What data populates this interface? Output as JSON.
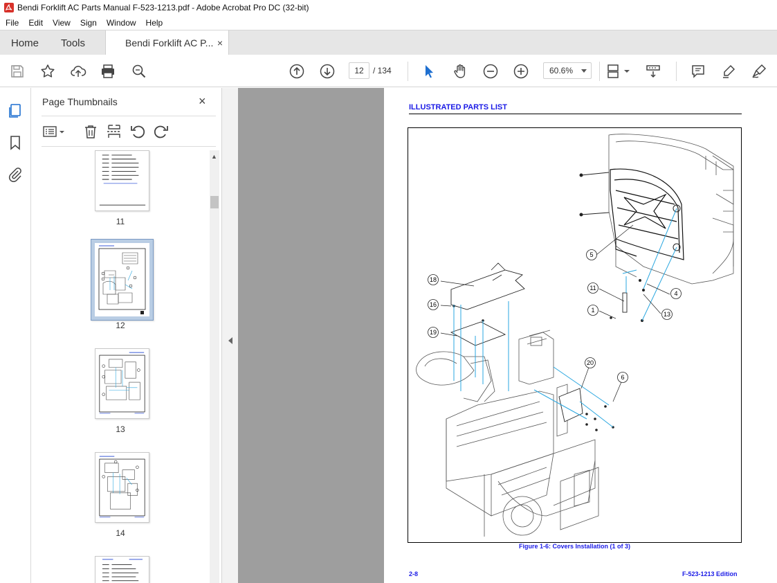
{
  "window": {
    "title": "Bendi Forklift AC Parts Manual F-523-1213.pdf - Adobe Acrobat Pro DC (32-bit)"
  },
  "menu": {
    "items": [
      "File",
      "Edit",
      "View",
      "Sign",
      "Window",
      "Help"
    ]
  },
  "tabs": {
    "home": "Home",
    "tools": "Tools",
    "document": "Bendi Forklift AC P...",
    "close": "×"
  },
  "toolbar": {
    "current_page": "12",
    "total_pages": "/ 134",
    "zoom": "60.6%"
  },
  "panel": {
    "title": "Page Thumbnails",
    "close": "×",
    "thumbnails": [
      {
        "label": "11",
        "selected": false
      },
      {
        "label": "12",
        "selected": true
      },
      {
        "label": "13",
        "selected": false
      },
      {
        "label": "14",
        "selected": false
      }
    ]
  },
  "document": {
    "header": "ILLUSTRATED PARTS LIST",
    "caption": "Figure 1-6:  Covers Installation (1 of 3)",
    "footer_left": "2-8",
    "footer_right": "F-523-1213 Edition",
    "callouts": [
      "5",
      "18",
      "16",
      "19",
      "11",
      "4",
      "1",
      "13",
      "20",
      "6"
    ]
  },
  "colors": {
    "accent_blue": "#1a1ae6",
    "leader_cyan": "#2aa7e0",
    "canvas_gray": "#9e9e9e",
    "selected_thumb": "#b9cde4",
    "icon_blue": "#1e6fd0"
  }
}
